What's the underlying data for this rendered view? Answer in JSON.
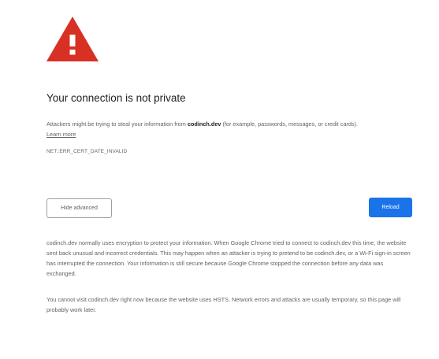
{
  "header": {
    "title": "Your connection is not private"
  },
  "main_message": {
    "prefix": "Attackers might be trying to steal your information from ",
    "domain": "codinch.dev",
    "suffix": " (for example, passwords, messages, or credit cards).",
    "learn_more": "Learn more"
  },
  "error_code": "NET::ERR_CERT_DATE_INVALID",
  "buttons": {
    "hide_advanced": "Hide advanced",
    "reload": "Reload"
  },
  "details": {
    "paragraph1": "codinch.dev normally uses encryption to protect your information. When Google Chrome tried to connect to codinch.dev this time, the website sent back unusual and incorrect credentials. This may happen when an attacker is trying to pretend to be codinch.dev, or a Wi-Fi sign-in screen has interrupted the connection. Your information is still secure because Google Chrome stopped the connection before any data was exchanged.",
    "paragraph2": "You cannot visit codinch.dev right now because the website uses HSTS. Network errors and attacks are usually temporary, so this page will probably work later."
  },
  "icons": {
    "warning": "warning-triangle-icon"
  },
  "colors": {
    "warning_red": "#d93025",
    "primary_blue": "#1a73e8",
    "title_text": "#202124",
    "body_text": "#5f6368"
  }
}
